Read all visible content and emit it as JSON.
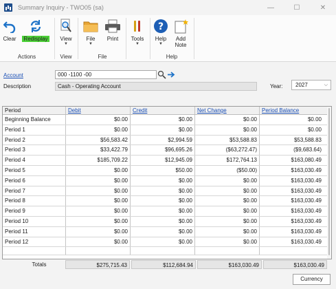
{
  "window": {
    "title": "Summary Inquiry  -  TWO05 (sa)",
    "minimize": "—",
    "maximize": "☐",
    "close": "✕"
  },
  "ribbon": {
    "clear": "Clear",
    "redisplay": "Redisplay",
    "view": "View",
    "file": "File",
    "print": "Print",
    "tools": "Tools",
    "help": "Help",
    "add_note_line1": "Add",
    "add_note_line2": "Note",
    "groups": {
      "actions": "Actions",
      "view": "View",
      "file": "File",
      "tools": "",
      "help": "Help"
    },
    "highlight_color": "#4cd137"
  },
  "form": {
    "account_label": "Account",
    "account_value": "000 -1100 -00",
    "description_label": "Description",
    "description_value": "Cash - Operating Account",
    "year_label": "Year:",
    "year_value": "2027"
  },
  "grid": {
    "columns": [
      "Period",
      "Debit",
      "Credit",
      "Net Change",
      "Period Balance"
    ],
    "rows": [
      [
        "Beginning Balance",
        "$0.00",
        "$0.00",
        "$0.00",
        "$0.00"
      ],
      [
        "Period 1",
        "$0.00",
        "$0.00",
        "$0.00",
        "$0.00"
      ],
      [
        "Period 2",
        "$56,583.42",
        "$2,994.59",
        "$53,588.83",
        "$53,588.83"
      ],
      [
        "Period 3",
        "$33,422.79",
        "$96,695.26",
        "($63,272.47)",
        "($9,683.64)"
      ],
      [
        "Period 4",
        "$185,709.22",
        "$12,945.09",
        "$172,764.13",
        "$163,080.49"
      ],
      [
        "Period 5",
        "$0.00",
        "$50.00",
        "($50.00)",
        "$163,030.49"
      ],
      [
        "Period 6",
        "$0.00",
        "$0.00",
        "$0.00",
        "$163,030.49"
      ],
      [
        "Period 7",
        "$0.00",
        "$0.00",
        "$0.00",
        "$163,030.49"
      ],
      [
        "Period 8",
        "$0.00",
        "$0.00",
        "$0.00",
        "$163,030.49"
      ],
      [
        "Period 9",
        "$0.00",
        "$0.00",
        "$0.00",
        "$163,030.49"
      ],
      [
        "Period 10",
        "$0.00",
        "$0.00",
        "$0.00",
        "$163,030.49"
      ],
      [
        "Period 11",
        "$0.00",
        "$0.00",
        "$0.00",
        "$163,030.49"
      ],
      [
        "Period 12",
        "$0.00",
        "$0.00",
        "$0.00",
        "$163,030.49"
      ]
    ]
  },
  "totals": {
    "label": "Totals",
    "debit": "$275,715.43",
    "credit": "$112,684.94",
    "net_change": "$163,030.49",
    "period_balance": "$163,030.49"
  },
  "buttons": {
    "currency": "Currency"
  }
}
